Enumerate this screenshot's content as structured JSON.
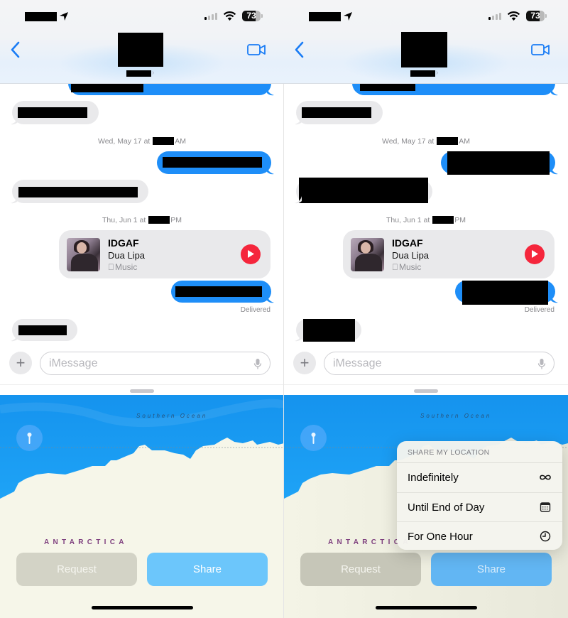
{
  "status_bar": {
    "time": "[redacted]",
    "battery_level": "73",
    "battery_fraction": 0.73,
    "signal_bars_on": 1,
    "signal_bars_total": 4
  },
  "header": {
    "back_label": "Back",
    "contact_name": "[redacted]",
    "video_call_label": "FaceTime"
  },
  "thread": {
    "timestamps": [
      {
        "day": "Wed, May 17 at",
        "meridiem": "AM"
      },
      {
        "day": "Thu, Jun 1 at",
        "meridiem": "PM"
      }
    ],
    "music_card": {
      "title": "IDGAF",
      "artist": "Dua Lipa",
      "source": "Music"
    },
    "delivered_label": "Delivered"
  },
  "composer": {
    "placeholder": "iMessage",
    "plus_label": "+"
  },
  "map": {
    "ocean_label": "Southern Ocean",
    "continent_label": "ANTARCTICA"
  },
  "actions": {
    "request_label": "Request",
    "share_label": "Share"
  },
  "share_menu": {
    "header": "SHARE MY LOCATION",
    "items": [
      {
        "label": "Indefinitely",
        "icon": "infinity-icon"
      },
      {
        "label": "Until End of Day",
        "icon": "calendar-icon"
      },
      {
        "label": "For One Hour",
        "icon": "clock-icon"
      }
    ]
  },
  "colors": {
    "imessage_blue": "#1e8ef8",
    "incoming_gray": "#e9e9eb",
    "music_red": "#f5263c",
    "share_blue": "#6cc6fb",
    "ocean_blue": "#1a9af0",
    "land": "#f6f6e9",
    "continent_label": "#7e3f7e"
  }
}
